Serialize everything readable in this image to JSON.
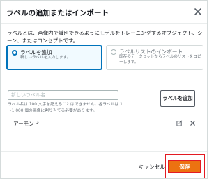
{
  "dialog": {
    "title": "ラベルの追加またはインポート",
    "description": "ラベルとは、画像内で識別できるようにモデルをトレーニングするオブジェクト、シーン、またはコンセプトです。"
  },
  "options": {
    "add": {
      "label": "ラベルを追加",
      "description": "新しいラベルを入力します。",
      "selected": true
    },
    "import": {
      "label": "ラベルリストのインポート",
      "description": "既存のデータセットからラベルのリストをコピーします。",
      "selected": false
    }
  },
  "new_label": {
    "placeholder": "新しいラベル名",
    "constraint": "ラベル名は 100 文字を超えることはできません。各ラベルは 1～1,000 個の画像に割り当てる必要があります。",
    "add_button_label": "ラベルを追加"
  },
  "labels": [
    {
      "name": "アーモンド"
    }
  ],
  "footer": {
    "cancel_label": "キャンセル",
    "save_label": "保存"
  },
  "colors": {
    "accent_blue": "#0073bb",
    "primary_orange": "#ec7211",
    "highlight_red": "#e31b23"
  }
}
